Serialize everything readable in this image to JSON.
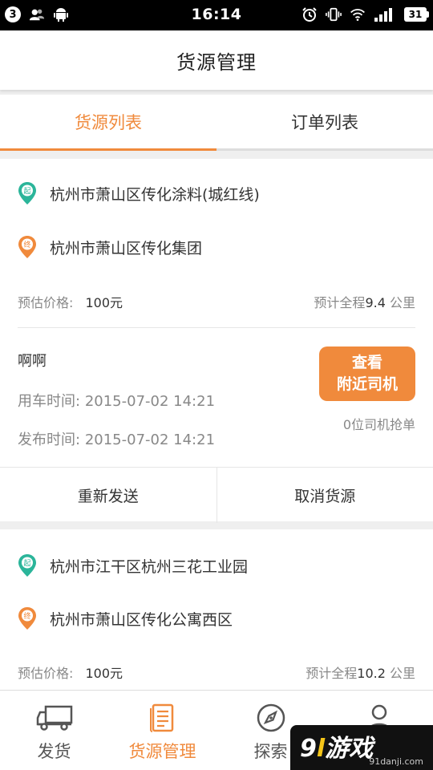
{
  "status_bar": {
    "notification_count": "3",
    "time": "16:14",
    "battery": "31"
  },
  "app_bar": {
    "title": "货源管理"
  },
  "tabs": [
    {
      "label": "货源列表",
      "active": true
    },
    {
      "label": "订单列表",
      "active": false
    }
  ],
  "cards": [
    {
      "origin": "杭州市萧山区传化涂料(城红线)",
      "origin_pin_text": "起",
      "destination": "杭州市萧山区传化集团",
      "destination_pin_text": "终",
      "price_label": "预估价格:",
      "price_value": "100元",
      "distance_label": "预计全程",
      "distance_value": "9.4",
      "distance_unit": "公里",
      "remark": "啊啊",
      "use_time_label": "用车时间:",
      "use_time_value": "2015-07-02 14:21",
      "publish_time_label": "发布时间:",
      "publish_time_value": "2015-07-02 14:21",
      "nearby_button_line1": "查看",
      "nearby_button_line2": "附近司机",
      "grab_count_text": "0位司机抢单",
      "resend_label": "重新发送",
      "cancel_label": "取消货源"
    },
    {
      "origin": "杭州市江干区杭州三花工业园",
      "origin_pin_text": "起",
      "destination": "杭州市萧山区传化公寓西区",
      "destination_pin_text": "终",
      "price_label": "预估价格:",
      "price_value": "100元",
      "distance_label": "预计全程",
      "distance_value": "10.2",
      "distance_unit": "公里"
    }
  ],
  "bottom_nav": [
    {
      "label": "发货",
      "icon": "truck-icon",
      "active": false
    },
    {
      "label": "货源管理",
      "icon": "document-icon",
      "active": true
    },
    {
      "label": "探索",
      "icon": "compass-icon",
      "active": false
    },
    {
      "label": "",
      "icon": "user-icon",
      "active": false
    }
  ],
  "watermark": {
    "logo_a": "9",
    "logo_b": "l",
    "logo_c": "游戏",
    "url": "91danji.com"
  },
  "colors": {
    "accent": "#f08a3c",
    "start_pin": "#2bb59a",
    "end_pin": "#f08a3c"
  }
}
